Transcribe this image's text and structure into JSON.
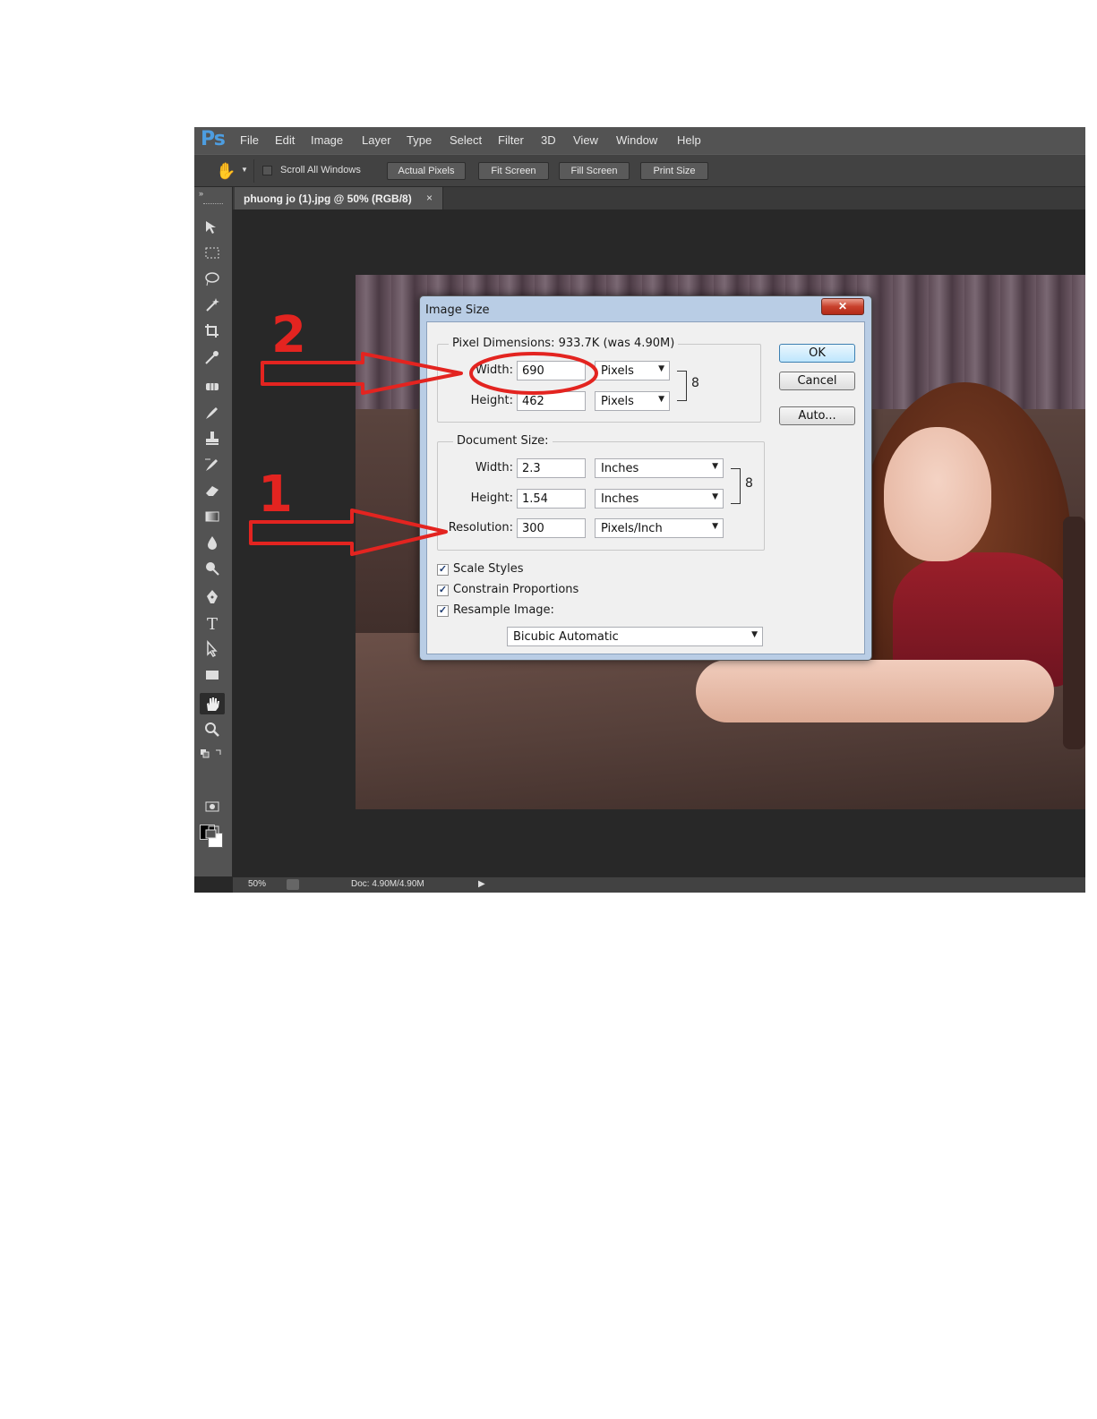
{
  "app": {
    "logo": "Ps",
    "menu": [
      "File",
      "Edit",
      "Image",
      "Layer",
      "Type",
      "Select",
      "Filter",
      "3D",
      "View",
      "Window",
      "Help"
    ]
  },
  "options_bar": {
    "tool_icon": "hand-icon",
    "scroll_all_label": "Scroll All Windows",
    "scroll_all_checked": false,
    "buttons": [
      "Actual Pixels",
      "Fit Screen",
      "Fill Screen",
      "Print Size"
    ]
  },
  "document_tab": {
    "name": "phuong jo (1).jpg @ 50% (RGB/8)",
    "close": "×"
  },
  "toolbox": {
    "collapse_glyph": "»",
    "tools": [
      "move-icon",
      "marquee-icon",
      "lasso-icon",
      "magic-wand-icon",
      "crop-icon",
      "eyedropper-icon",
      "healing-brush-icon",
      "brush-icon",
      "clone-stamp-icon",
      "history-brush-icon",
      "eraser-icon",
      "gradient-icon",
      "blur-icon",
      "dodge-icon",
      "pen-icon",
      "type-icon",
      "path-selection-icon",
      "rectangle-icon",
      "hand-icon",
      "zoom-icon"
    ],
    "active_tool": "hand-icon",
    "foreground_color": "#000000",
    "background_color": "#ffffff"
  },
  "status_bar": {
    "zoom": "50%",
    "doc": "Doc: 4.90M/4.90M",
    "arrow": "▶"
  },
  "dialog": {
    "title": "Image Size",
    "close": "✕",
    "pixel_dimensions": {
      "title": "Pixel Dimensions:  933.7K (was 4.90M)",
      "width_label": "Width:",
      "width_value": "690",
      "width_unit": "Pixels",
      "height_label": "Height:",
      "height_value": "462",
      "height_unit": "Pixels"
    },
    "document_size": {
      "title": "Document Size:",
      "width_label": "Width:",
      "width_value": "2.3",
      "width_unit": "Inches",
      "height_label": "Height:",
      "height_value": "1.54",
      "height_unit": "Inches",
      "resolution_label": "Resolution:",
      "resolution_value": "300",
      "resolution_unit": "Pixels/Inch"
    },
    "buttons": {
      "ok": "OK",
      "cancel": "Cancel",
      "auto": "Auto..."
    },
    "checkboxes": [
      {
        "label": "Scale Styles",
        "checked": true
      },
      {
        "label": "Constrain Proportions",
        "checked": true
      },
      {
        "label": "Resample Image:",
        "checked": true
      }
    ],
    "resample_method": "Bicubic Automatic",
    "check_glyph": "✓",
    "dropdown_glyph": "▼",
    "chain_glyph": "8"
  },
  "annotations": {
    "step_2": "2",
    "step_1": "1",
    "color": "#e32420"
  }
}
